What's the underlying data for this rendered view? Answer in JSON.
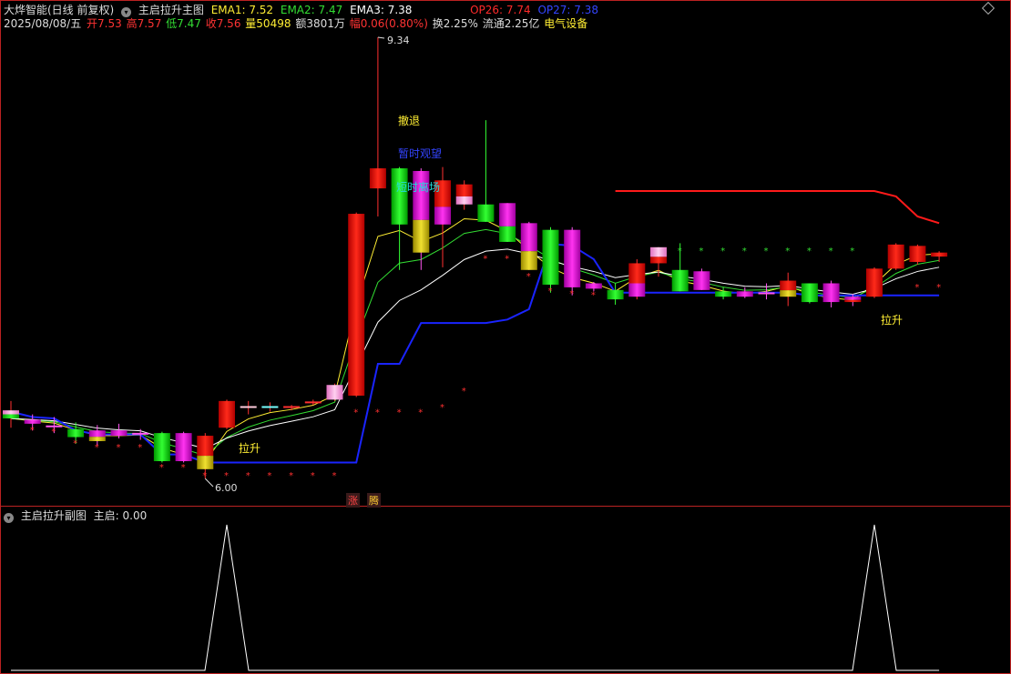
{
  "header": {
    "stock_name": "大烨智能(日线 前复权)",
    "indicator_name": "主启拉升主图",
    "ema1": "EMA1: 7.52",
    "ema2": "EMA2: 7.47",
    "ema3": "EMA3: 7.38",
    "op26": "OP26: 7.74",
    "op27": "OP27: 7.38",
    "date": "2025/08/08/五",
    "open": "开7.53",
    "high": "高7.57",
    "low": "低7.47",
    "close": "收7.56",
    "volume": "量50498",
    "amount": "额3801万",
    "change": "幅0.06(0.80%)",
    "turnover": "换2.25%",
    "float_cap": "流通2.25亿",
    "sector": "电气设备"
  },
  "sub_header": {
    "indicator_name": "主启拉升副图",
    "value": "主启: 0.00"
  },
  "annotations": {
    "max_price": "9.34",
    "min_price": "6.00",
    "retreat": "撤退",
    "wait": "暂时观望",
    "exit": "短时离场",
    "rise1": "拉升",
    "rise2": "拉升",
    "tag_zhang": "涨",
    "tag_teng": "腾"
  },
  "colors": {
    "up": "#e8140f",
    "down": "#11cc11",
    "magenta": "#e81ee0",
    "yellow": "#e8d020",
    "pink": "#ff9bd8",
    "blue": "#1a24ff",
    "red_line": "#ff1a1a",
    "white": "#ffffff",
    "green_line": "#33dd33",
    "yellow_line": "#ffee33",
    "text_yellow": "#ffee33",
    "text_blue": "#3344ff",
    "text_cyan": "#22dddd"
  },
  "chart_data": {
    "type": "candlestick",
    "price_range": [
      6.0,
      9.34
    ],
    "candles": [
      {
        "o": 6.55,
        "h": 6.62,
        "l": 6.42,
        "c": 6.49,
        "style": "pink-green"
      },
      {
        "o": 6.48,
        "h": 6.52,
        "l": 6.4,
        "c": 6.45,
        "style": "magenta"
      },
      {
        "o": 6.42,
        "h": 6.5,
        "l": 6.38,
        "c": 6.44,
        "style": "magenta-cross"
      },
      {
        "o": 6.41,
        "h": 6.46,
        "l": 6.3,
        "c": 6.35,
        "style": "green"
      },
      {
        "o": 6.4,
        "h": 6.44,
        "l": 6.29,
        "c": 6.32,
        "style": "magenta-yellow"
      },
      {
        "o": 6.4,
        "h": 6.45,
        "l": 6.34,
        "c": 6.36,
        "style": "magenta"
      },
      {
        "o": 6.38,
        "h": 6.41,
        "l": 6.33,
        "c": 6.37,
        "style": "magenta-cross"
      },
      {
        "o": 6.38,
        "h": 6.39,
        "l": 6.16,
        "c": 6.17,
        "style": "green"
      },
      {
        "o": 6.38,
        "h": 6.39,
        "l": 6.16,
        "c": 6.17,
        "style": "magenta"
      },
      {
        "o": 6.36,
        "h": 6.38,
        "l": 6.04,
        "c": 6.11,
        "style": "red-yellow"
      },
      {
        "o": 6.42,
        "h": 6.63,
        "l": 6.41,
        "c": 6.62,
        "style": "red"
      },
      {
        "o": 6.57,
        "h": 6.62,
        "l": 6.52,
        "c": 6.58,
        "style": "pink-cross"
      },
      {
        "o": 6.57,
        "h": 6.61,
        "l": 6.54,
        "c": 6.58,
        "style": "cyan-cross"
      },
      {
        "o": 6.57,
        "h": 6.59,
        "l": 6.55,
        "c": 6.58,
        "style": "red-cross"
      },
      {
        "o": 6.6,
        "h": 6.63,
        "l": 6.59,
        "c": 6.62,
        "style": "red-cross"
      },
      {
        "o": 6.63,
        "h": 6.75,
        "l": 6.62,
        "c": 6.74,
        "style": "pink"
      },
      {
        "o": 6.66,
        "h": 8.03,
        "l": 6.65,
        "c": 8.02,
        "style": "red"
      },
      {
        "o": 8.21,
        "h": 9.34,
        "l": 8.0,
        "c": 8.36,
        "style": "red"
      },
      {
        "o": 8.36,
        "h": 8.37,
        "l": 7.6,
        "c": 7.94,
        "style": "green"
      },
      {
        "o": 8.34,
        "h": 8.36,
        "l": 7.6,
        "c": 7.73,
        "style": "magenta-yellow"
      },
      {
        "o": 8.27,
        "h": 8.37,
        "l": 7.62,
        "c": 7.94,
        "style": "red-magenta"
      },
      {
        "o": 8.24,
        "h": 8.27,
        "l": 8.05,
        "c": 8.09,
        "style": "red-pink"
      },
      {
        "o": 8.09,
        "h": 8.72,
        "l": 7.96,
        "c": 7.96,
        "style": "green"
      },
      {
        "o": 8.1,
        "h": 8.1,
        "l": 7.81,
        "c": 7.81,
        "style": "magenta-green"
      },
      {
        "o": 7.95,
        "h": 7.96,
        "l": 7.6,
        "c": 7.6,
        "style": "magenta-yellow"
      },
      {
        "o": 7.9,
        "h": 7.92,
        "l": 7.43,
        "c": 7.49,
        "style": "green"
      },
      {
        "o": 7.9,
        "h": 7.92,
        "l": 7.41,
        "c": 7.47,
        "style": "magenta"
      },
      {
        "o": 7.5,
        "h": 7.51,
        "l": 7.44,
        "c": 7.46,
        "style": "magenta"
      },
      {
        "o": 7.45,
        "h": 7.5,
        "l": 7.34,
        "c": 7.38,
        "style": "green"
      },
      {
        "o": 7.4,
        "h": 7.68,
        "l": 7.38,
        "c": 7.65,
        "style": "red-magenta"
      },
      {
        "o": 7.77,
        "h": 7.77,
        "l": 7.55,
        "c": 7.65,
        "style": "pink-red"
      },
      {
        "o": 7.6,
        "h": 7.8,
        "l": 7.44,
        "c": 7.44,
        "style": "green"
      },
      {
        "o": 7.59,
        "h": 7.61,
        "l": 7.45,
        "c": 7.45,
        "style": "magenta"
      },
      {
        "o": 7.44,
        "h": 7.47,
        "l": 7.38,
        "c": 7.4,
        "style": "green"
      },
      {
        "o": 7.44,
        "h": 7.47,
        "l": 7.39,
        "c": 7.4,
        "style": "magenta"
      },
      {
        "o": 7.39,
        "h": 7.5,
        "l": 7.38,
        "c": 7.46,
        "style": "magenta-cross"
      },
      {
        "o": 7.4,
        "h": 7.58,
        "l": 7.33,
        "c": 7.52,
        "style": "red-yellow"
      },
      {
        "o": 7.5,
        "h": 7.5,
        "l": 7.35,
        "c": 7.36,
        "style": "green"
      },
      {
        "o": 7.5,
        "h": 7.52,
        "l": 7.32,
        "c": 7.36,
        "style": "magenta"
      },
      {
        "o": 7.4,
        "h": 7.42,
        "l": 7.33,
        "c": 7.36,
        "style": "magenta-red"
      },
      {
        "o": 7.4,
        "h": 7.62,
        "l": 7.39,
        "c": 7.61,
        "style": "red"
      },
      {
        "o": 7.61,
        "h": 7.8,
        "l": 7.6,
        "c": 7.79,
        "style": "red"
      },
      {
        "o": 7.66,
        "h": 7.79,
        "l": 7.64,
        "c": 7.78,
        "style": "red"
      },
      {
        "o": 7.7,
        "h": 7.74,
        "l": 7.66,
        "c": 7.73,
        "style": "red"
      }
    ],
    "sub_signal_spikes": [
      10,
      40
    ]
  }
}
